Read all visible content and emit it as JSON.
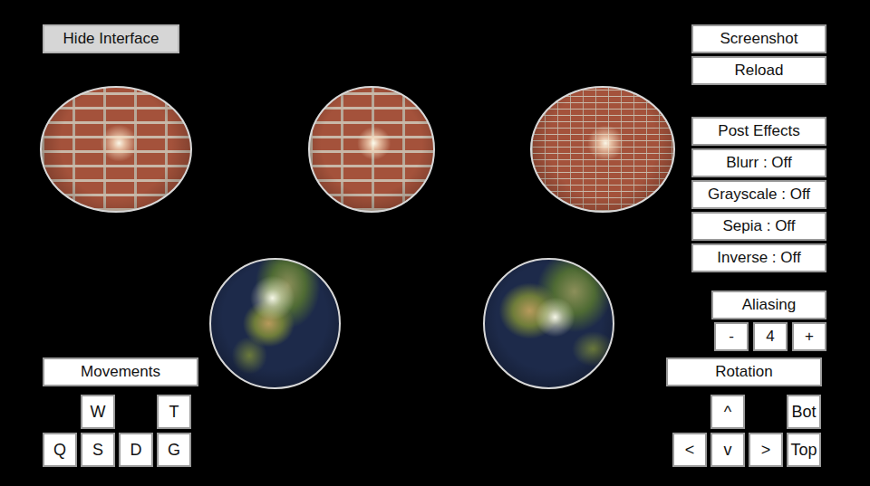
{
  "hide_button": {
    "label": "Hide Interface",
    "selected": true
  },
  "top_actions": [
    "Screenshot",
    "Reload"
  ],
  "post_effects": {
    "title": "Post Effects",
    "items": [
      {
        "label": "Blurr : Off",
        "on": false
      },
      {
        "label": "Grayscale : Off",
        "on": false
      },
      {
        "label": "Sepia : Off",
        "on": false
      },
      {
        "label": "Inverse : Off",
        "on": false
      }
    ]
  },
  "aliasing": {
    "title": "Aliasing",
    "decrease": "-",
    "value": "4",
    "increase": "+"
  },
  "movements": {
    "title": "Movements",
    "rows": [
      [
        "W",
        "T"
      ],
      [
        "Q",
        "S",
        "D",
        "G"
      ]
    ]
  },
  "rotation": {
    "title": "Rotation",
    "rows": [
      [
        "^",
        "Bot"
      ],
      [
        "<",
        "v",
        ">",
        "Top"
      ]
    ]
  },
  "scene": {
    "objects": [
      {
        "kind": "brick",
        "shape": "wide"
      },
      {
        "kind": "brick",
        "shape": "round"
      },
      {
        "kind": "brick",
        "shape": "fine"
      },
      {
        "kind": "earth",
        "shape": "africa"
      },
      {
        "kind": "earth",
        "shape": "asia"
      }
    ]
  }
}
